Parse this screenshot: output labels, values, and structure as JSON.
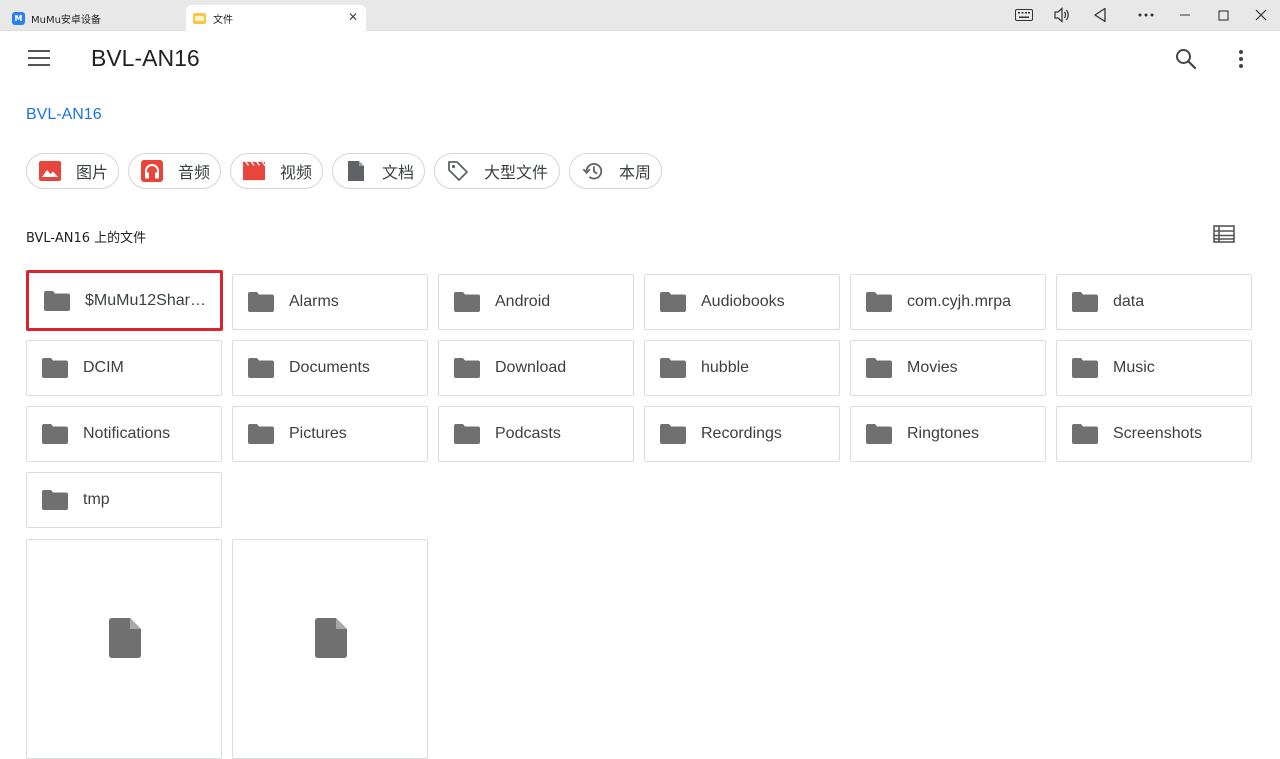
{
  "window": {
    "tabs": [
      {
        "label": "MuMu安卓设备",
        "icon": "mumu-logo-icon"
      },
      {
        "label": "文件",
        "icon": "folder-icon",
        "active": true,
        "close": "✕"
      }
    ],
    "controls": [
      "keyboard-icon",
      "volume-icon",
      "back-icon",
      "more-horizontal-icon",
      "minimize-icon",
      "maximize-icon",
      "close-icon"
    ],
    "app_logo_text": "M"
  },
  "header": {
    "title": "BVL-AN16",
    "menu_icon": "hamburger-menu-icon",
    "search_icon": "search-icon",
    "overflow_icon": "more-vertical-icon"
  },
  "breadcrumb": "BVL-AN16",
  "chips": [
    {
      "label": "图片",
      "icon": "image-icon",
      "color": "#e8453c"
    },
    {
      "label": "音频",
      "icon": "headphones-icon",
      "color": "#e8453c"
    },
    {
      "label": "视频",
      "icon": "movie-icon",
      "color": "#e8453c"
    },
    {
      "label": "文档",
      "icon": "document-icon",
      "color": "#5f6368"
    },
    {
      "label": "大型文件",
      "icon": "tag-icon",
      "color": "#5f6368"
    },
    {
      "label": "本周",
      "icon": "history-icon",
      "color": "#5f6368"
    }
  ],
  "section": {
    "label": "BVL-AN16 上的文件",
    "view_toggle_icon": "list-view-icon"
  },
  "folders": [
    {
      "name": "$MuMu12Shar…",
      "selected": true
    },
    {
      "name": "Alarms"
    },
    {
      "name": "Android"
    },
    {
      "name": "Audiobooks"
    },
    {
      "name": "com.cyjh.mrpa"
    },
    {
      "name": "data"
    },
    {
      "name": "DCIM"
    },
    {
      "name": "Documents"
    },
    {
      "name": "Download"
    },
    {
      "name": "hubble"
    },
    {
      "name": "Movies"
    },
    {
      "name": "Music"
    },
    {
      "name": "Notifications"
    },
    {
      "name": "Pictures"
    },
    {
      "name": "Podcasts"
    },
    {
      "name": "Recordings"
    },
    {
      "name": "Ringtones"
    },
    {
      "name": "Screenshots"
    },
    {
      "name": "tmp"
    }
  ],
  "files": [
    {
      "icon": "file-icon"
    },
    {
      "icon": "file-icon"
    }
  ],
  "colors": {
    "accent": "#1a73e8",
    "selection": "#d9252c",
    "icon_gray": "#707070"
  }
}
